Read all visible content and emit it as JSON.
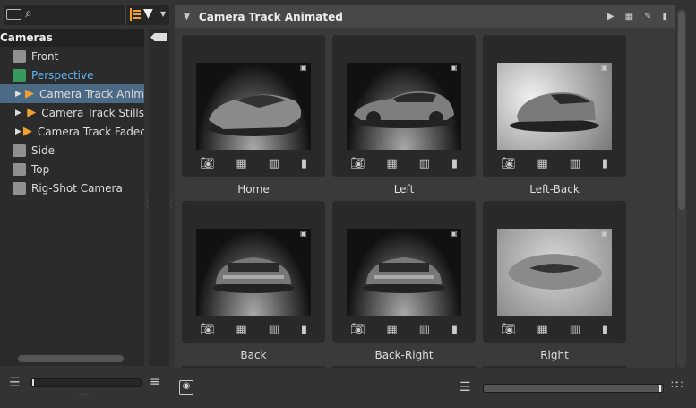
{
  "search": {
    "placeholder": ""
  },
  "tree": {
    "header": "Cameras",
    "items": [
      {
        "label": "Front",
        "icon": "camera-front-icon",
        "indent": 0
      },
      {
        "label": "Perspective",
        "icon": "perspective-camera-icon",
        "indent": 0,
        "color": "#5fb3f0"
      },
      {
        "label": "Camera Track Animated",
        "display": "Camera Track Anim",
        "icon": "track-icon",
        "indent": 1,
        "selected": true
      },
      {
        "label": "Camera Track Stills",
        "icon": "track-icon",
        "indent": 1
      },
      {
        "label": "Camera Track Faded",
        "display": "Camera Track Fadec",
        "icon": "track-icon",
        "indent": 1
      },
      {
        "label": "Side",
        "icon": "camera-side-icon",
        "indent": 0
      },
      {
        "label": "Top",
        "icon": "camera-top-icon",
        "indent": 0
      },
      {
        "label": "Rig-Shot Camera",
        "icon": "rig-camera-icon",
        "indent": 0
      }
    ]
  },
  "panel": {
    "title": "Camera Track Animated"
  },
  "cards": [
    {
      "label": "Home",
      "view": "home"
    },
    {
      "label": "Left",
      "view": "left"
    },
    {
      "label": "Left-Back",
      "view": "leftback"
    },
    {
      "label": "Back",
      "view": "back"
    },
    {
      "label": "Back-Right",
      "view": "back"
    },
    {
      "label": "Right",
      "view": "right"
    }
  ],
  "colors": {
    "accent": "#f0a030",
    "selected": "#4a6a86",
    "perspective": "#5fb3f0"
  }
}
